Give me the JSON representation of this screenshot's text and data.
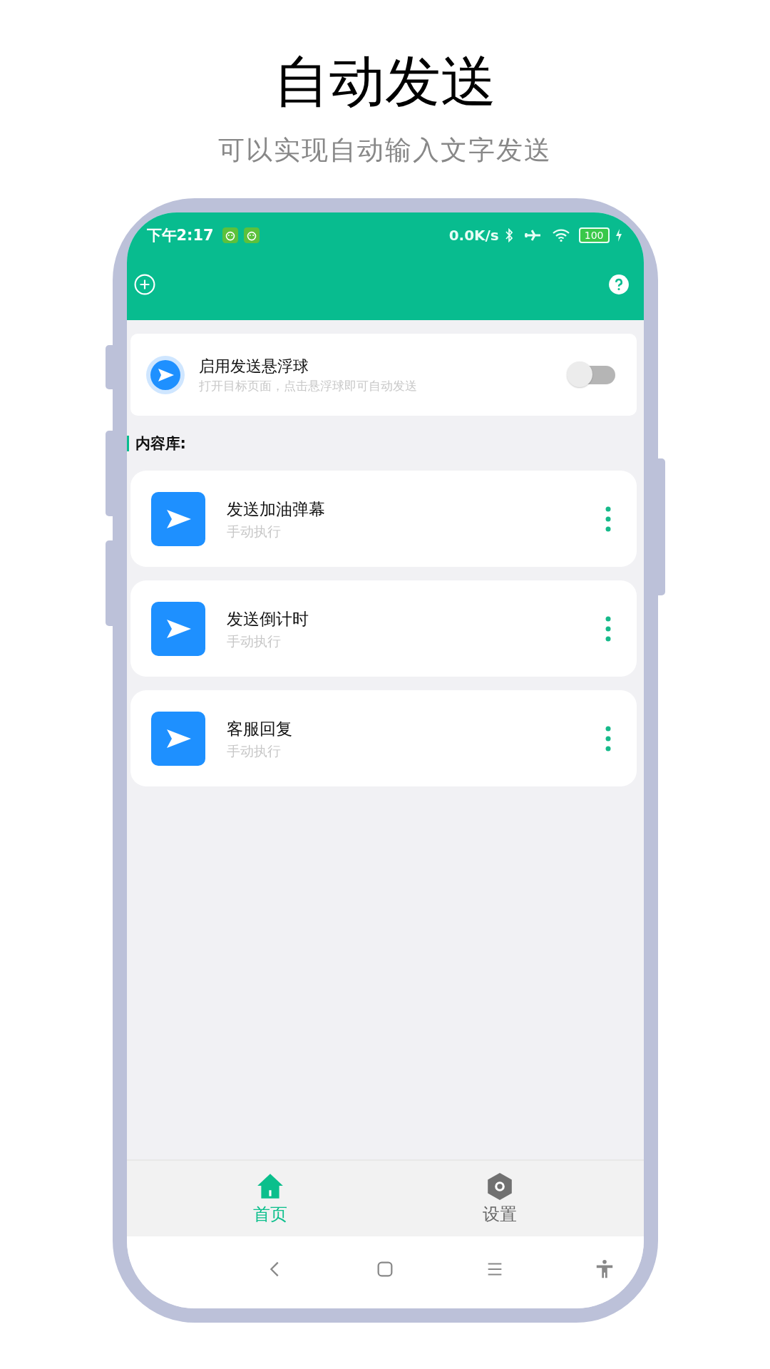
{
  "heading": "自动发送",
  "subheading": "可以实现自动输入文字发送",
  "status_bar": {
    "time": "下午2:17",
    "net_speed": "0.0K/s",
    "battery": "100"
  },
  "floating_ball": {
    "title": "启用发送悬浮球",
    "subtitle": "打开目标页面，点击悬浮球即可自动发送",
    "on": false
  },
  "section_title": "内容库:",
  "items": [
    {
      "title": "发送加油弹幕",
      "subtitle": "手动执行"
    },
    {
      "title": "发送倒计时",
      "subtitle": "手动执行"
    },
    {
      "title": "客服回复",
      "subtitle": "手动执行"
    }
  ],
  "tabs": [
    {
      "label": "首页",
      "kind": "home",
      "selected": true
    },
    {
      "label": "设置",
      "kind": "settings",
      "selected": false
    }
  ]
}
